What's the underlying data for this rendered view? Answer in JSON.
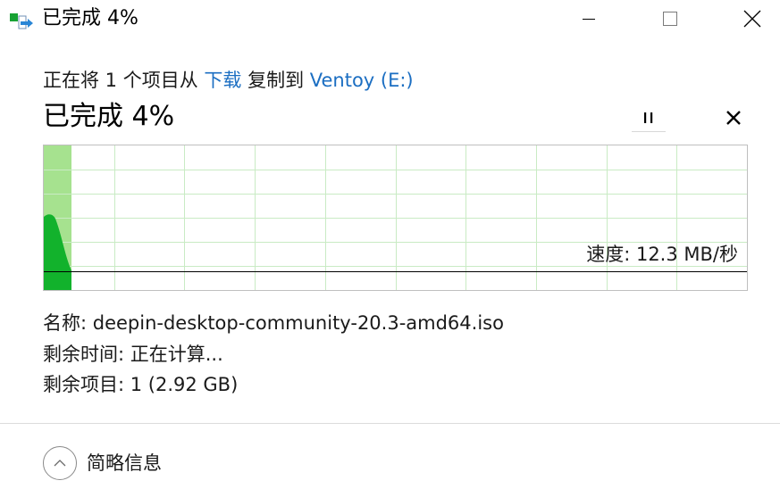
{
  "window": {
    "title": "已完成 4%",
    "icon": "file-copy-icon"
  },
  "controls": {
    "minimize_icon": "minimize-icon",
    "maximize_icon": "maximize-icon",
    "close_icon": "close-icon"
  },
  "status": {
    "prefix": "正在将 1 个项目从 ",
    "source": "下载",
    "middle": " 复制到 ",
    "destination": "Ventoy (E:)"
  },
  "progress": {
    "text": "已完成 4%",
    "percent": 4,
    "pause_icon": "pause-icon",
    "cancel_icon": "cancel-icon"
  },
  "speed": {
    "label": "速度: 12.3 MB/秒"
  },
  "details": {
    "name": "名称:  deepin-desktop-community-20.3-amd64.iso",
    "time_remaining": "剩余时间:  正在计算...",
    "items_remaining": "剩余项目:  1 (2.92 GB)"
  },
  "footer": {
    "less_details_label": "简略信息",
    "less_details_icon": "chevron-up-icon"
  },
  "colors": {
    "accent_link": "#1b6ec2",
    "progress_fill": "#a6e28f",
    "speed_area": "#12b22c",
    "grid": "#c9ebc4"
  }
}
